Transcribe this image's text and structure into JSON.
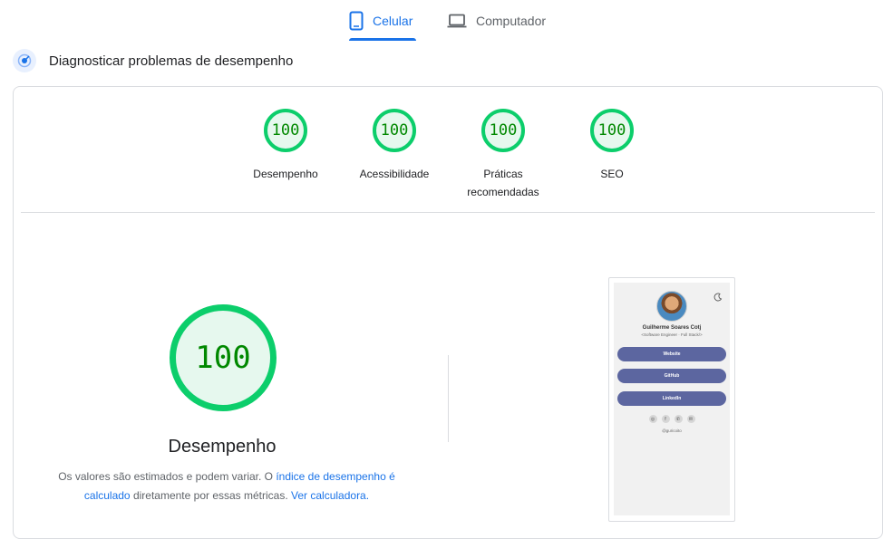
{
  "tabs": [
    {
      "label": "Celular",
      "icon": "phone-icon",
      "active": true
    },
    {
      "label": "Computador",
      "icon": "laptop-icon",
      "active": false
    }
  ],
  "diagnose": {
    "title": "Diagnosticar problemas de desempenho",
    "icon": "pagespeed-icon"
  },
  "gauges": [
    {
      "score": "100",
      "label": "Desempenho"
    },
    {
      "score": "100",
      "label": "Acessibilidade"
    },
    {
      "score": "100",
      "label": "Práticas recomendadas"
    },
    {
      "score": "100",
      "label": "SEO"
    }
  ],
  "main": {
    "score": "100",
    "label": "Desempenho",
    "desc_1": "Os valores são estimados e podem variar. O ",
    "link_1": "índice de desempenho é calculado",
    "desc_2": " diretamente por essas métricas. ",
    "link_2": "Ver calculadora."
  },
  "preview": {
    "name": "Guilherme Soares Cotj",
    "role": "<Software Engineer · Full Stack/>",
    "buttons": [
      "Website",
      "GitHub",
      "LinkedIn"
    ],
    "handle": "@guricoito"
  },
  "colors": {
    "pass": "#0cce6b",
    "pass_text": "#008800",
    "accent": "#1a73e8",
    "button": "#5c66a0"
  }
}
